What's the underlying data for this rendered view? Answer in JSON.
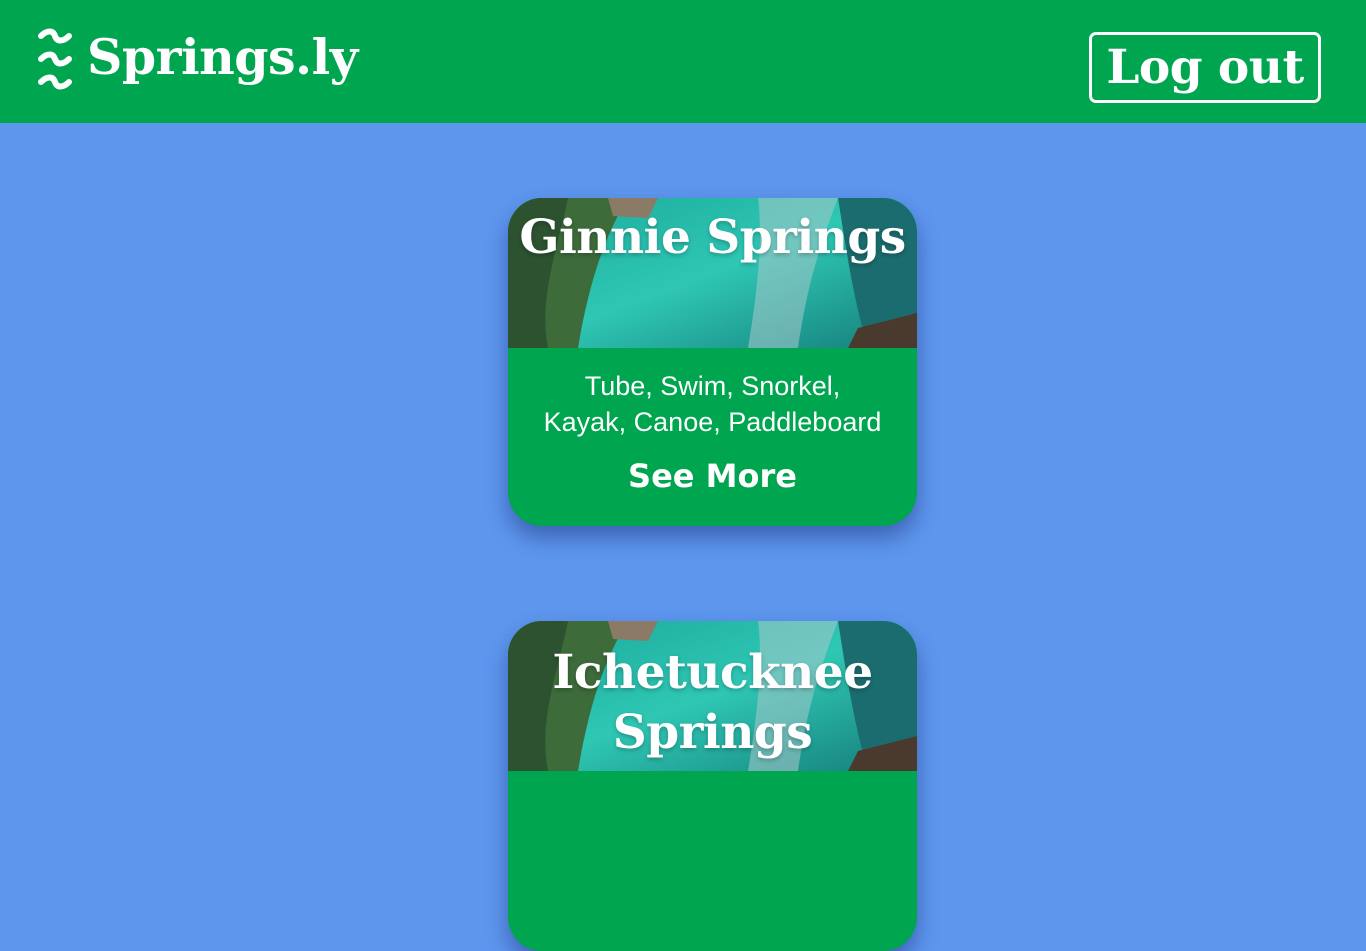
{
  "header": {
    "brand_name": "Springs.ly",
    "logout_label": "Log out"
  },
  "springs": [
    {
      "name": "Ginnie Springs",
      "activities_line1": "Tube, Swim, Snorkel,",
      "activities_line2": "Kayak, Canoe, Paddleboard",
      "see_more_label": "See More"
    },
    {
      "name": "Ichetucknee Springs"
    }
  ],
  "colors": {
    "navbar": "#00a550",
    "background": "#5e96ee",
    "card": "#00a550",
    "text": "#ffffff"
  },
  "icons": {
    "brand": "wave-icon"
  }
}
